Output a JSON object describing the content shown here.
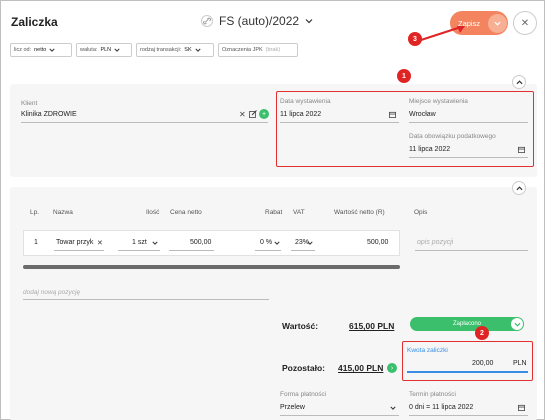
{
  "header": {
    "title": "Zaliczka",
    "doc_number": "FS (auto)/2022",
    "save_label": "Zapisz"
  },
  "filters": [
    {
      "label": "licz od:",
      "value": "netto"
    },
    {
      "label": "waluta:",
      "value": "PLN"
    },
    {
      "label": "rodzaj transakcji:",
      "value": "SK"
    },
    {
      "label": "Oznaczenia JPK",
      "value": "(brak)"
    }
  ],
  "annotations": [
    "1",
    "2",
    "3"
  ],
  "client": {
    "label": "Klient",
    "value": "Klinika ZDROWIE"
  },
  "dates": {
    "issue_label": "Data wystawienia",
    "issue_value": "11 lipca 2022",
    "place_label": "Miejsce wystawienia",
    "place_value": "Wrocław",
    "tax_label": "Data obowiązku podatkowego",
    "tax_value": "11 lipca 2022"
  },
  "table": {
    "headers": {
      "lp": "Lp.",
      "name": "Nazwa",
      "qty": "Ilość",
      "price": "Cena netto",
      "discount": "Rabat",
      "vat": "VAT",
      "net_value": "Wartość netto (R)",
      "desc": "Opis"
    },
    "rows": [
      {
        "lp": "1",
        "name": "Towar przyk",
        "qty": "1 szt",
        "price": "500,00",
        "discount": "0 %",
        "vat": "23%",
        "net_value": "500,00",
        "desc_placeholder": "opis pozycji"
      }
    ],
    "add_item_placeholder": "dodaj nową pozycję"
  },
  "summary": {
    "value_label": "Wartość:",
    "value_amount": "615,00 PLN",
    "paid_label": "Zapłacono",
    "remaining_label": "Pozostało:",
    "remaining_amount": "415,00 PLN",
    "advance_label": "Kwota zaliczki",
    "advance_value": "200,00",
    "advance_currency": "PLN"
  },
  "payment": {
    "form_label": "Forma płatności",
    "form_value": "Przelew",
    "term_label": "Termin płatności",
    "term_value": "0 dni = 11 lipca 2022"
  },
  "colors": {
    "accent_orange": "#f4845f",
    "green": "#3bbf6c",
    "annotation_red": "#e02424"
  }
}
